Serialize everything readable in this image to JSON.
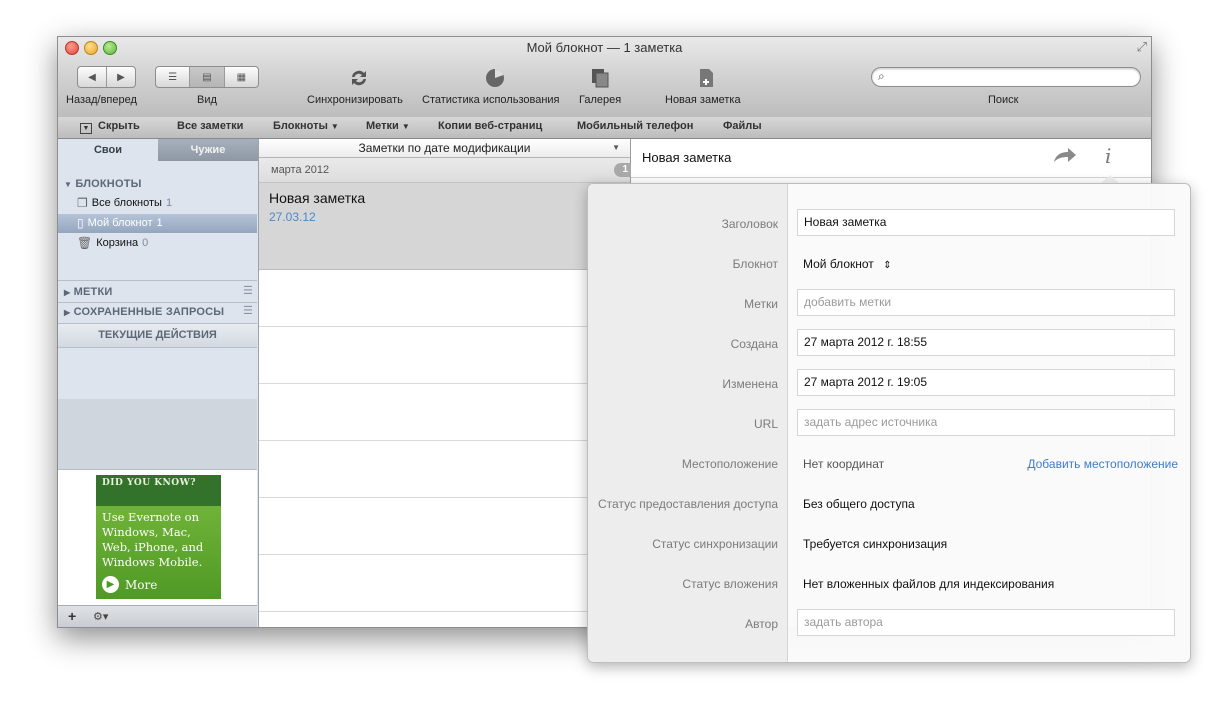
{
  "window": {
    "title": "Мой блокнот — 1 заметка"
  },
  "toolbar": {
    "back_forward_label": "Назад/вперед",
    "view_label": "Вид",
    "sync_label": "Синхронизировать",
    "stats_label": "Статистика использования",
    "gallery_label": "Галерея",
    "new_note_label": "Новая заметка",
    "search_label": "Поиск",
    "search_placeholder": ""
  },
  "filterbar": {
    "hide": "Скрыть",
    "all_notes": "Все заметки",
    "notebooks": "Блокноты",
    "tags": "Метки",
    "web_clips": "Копии веб-страниц",
    "mobile": "Мобильный телефон",
    "files": "Файлы"
  },
  "sidebar": {
    "tabs": [
      "Свои",
      "Чужие"
    ],
    "notebooks_header": "БЛОКНОТЫ",
    "items": [
      {
        "label": "Все блокноты",
        "count": "1"
      },
      {
        "label": "Мой блокнот",
        "count": "1"
      },
      {
        "label": "Корзина",
        "count": "0"
      }
    ],
    "tags_header": "МЕТКИ",
    "saved_header": "СОХРАНЕННЫЕ ЗАПРОСЫ",
    "current_header": "ТЕКУЩИЕ ДЕЙСТВИЯ",
    "ad": {
      "top": "DID YOU KNOW?",
      "body": "Use Evernote on Windows, Mac, Web, iPhone, and Windows Mobile.",
      "more": "More"
    },
    "bottom_add": "+",
    "bottom_gear": "⚙▾"
  },
  "notes": {
    "sort": "Заметки по дате модификации",
    "month": "марта 2012",
    "month_count": "1",
    "note": {
      "title": "Новая заметка",
      "date": "27.03.12"
    }
  },
  "editor": {
    "title": "Новая заметка"
  },
  "info": {
    "fields": [
      {
        "label": "Заголовок",
        "value": "Новая заметка",
        "type": "input"
      },
      {
        "label": "Блокнот",
        "value": "Мой блокнот",
        "type": "select"
      },
      {
        "label": "Метки",
        "value": "добавить метки",
        "type": "placeholder"
      },
      {
        "label": "Создана",
        "value": "27 марта 2012 г. 18:55",
        "type": "input"
      },
      {
        "label": "Изменена",
        "value": "27 марта 2012 г. 19:05",
        "type": "input"
      },
      {
        "label": "URL",
        "value": "задать адрес источника",
        "type": "placeholder"
      },
      {
        "label": "Местоположение",
        "value": "Нет координат",
        "type": "text",
        "link": "Добавить местоположение"
      },
      {
        "label": "Статус предоставления доступа",
        "value": "Без общего доступа",
        "type": "text"
      },
      {
        "label": "Статус синхронизации",
        "value": "Требуется синхронизация",
        "type": "text"
      },
      {
        "label": "Статус вложения",
        "value": "Нет вложенных файлов для индексирования",
        "type": "text"
      },
      {
        "label": "Автор",
        "value": "задать автора",
        "type": "placeholder"
      }
    ]
  },
  "colors": {
    "link": "#3d7cc9",
    "sidebar_bg": "#dde4ed",
    "ad_green": "#4f9a25"
  }
}
